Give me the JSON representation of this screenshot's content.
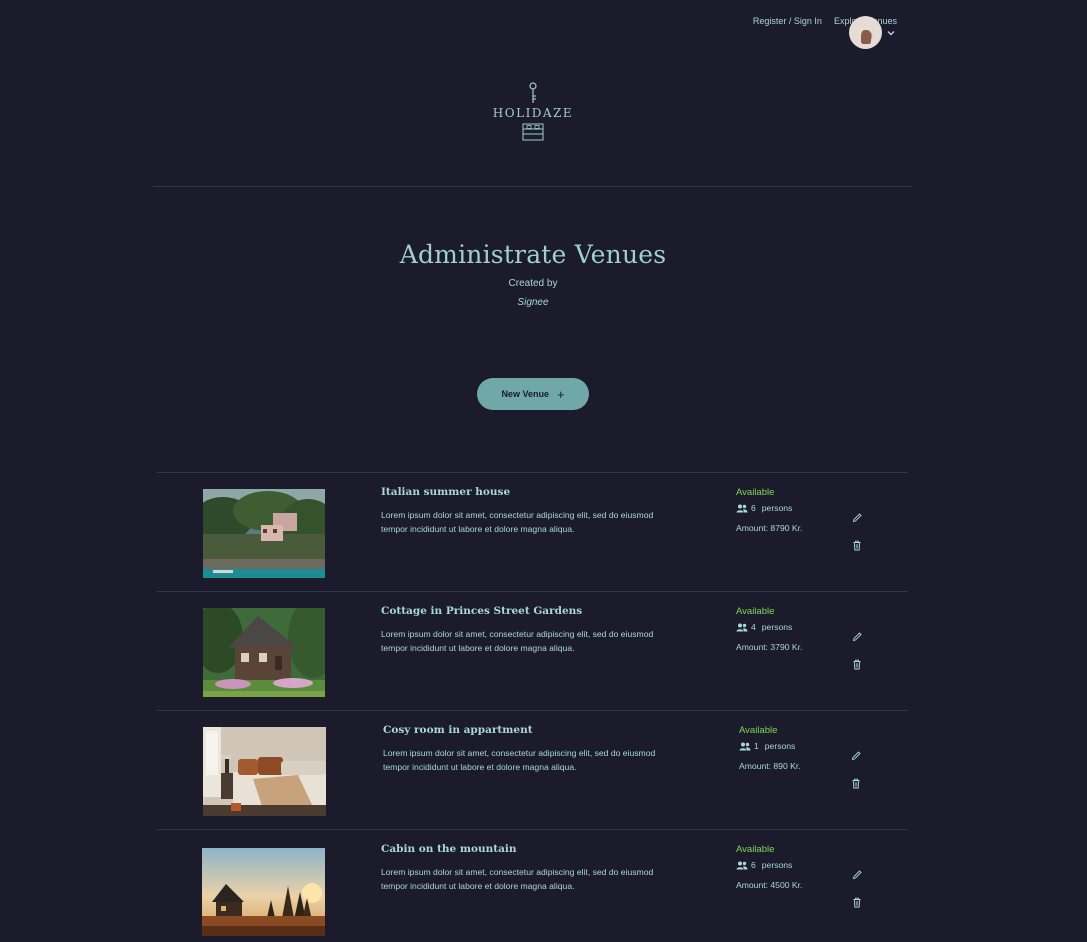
{
  "nav": {
    "register_label": "Register / Sign In",
    "explore_label": "Explore Venues"
  },
  "logo": {
    "text": "HOLIDAZE"
  },
  "page": {
    "title": "Administrate Venues",
    "created_by_label": "Created by",
    "author": "Signee"
  },
  "new_venue": {
    "label": "New Venue",
    "icon": "plus-icon"
  },
  "colors": {
    "background": "#1b1b2b",
    "text": "#9fcfcf",
    "accent": "#6fa8a6",
    "available": "#7fd65b"
  },
  "venues": [
    {
      "title": "Italian summer house",
      "description": "Lorem ipsum dolor sit amet, consectetur adipiscing elit, sed do eiusmod tempor incididunt ut labore et dolore magna aliqua.",
      "status": "Available",
      "persons": "6",
      "persons_label": "persons",
      "amount": "Amount: 8790 Kr.",
      "image": "coastal-villa-photo"
    },
    {
      "title": "Cottage in Princes Street Gardens",
      "description": "Lorem ipsum dolor sit amet, consectetur adipiscing elit, sed do eiusmod tempor incididunt ut labore et dolore magna aliqua.",
      "status": "Available",
      "persons": "4",
      "persons_label": "persons",
      "amount": "Amount: 3790 Kr.",
      "image": "stone-cottage-photo"
    },
    {
      "title": "Cosy room in appartment",
      "description": "Lorem ipsum dolor sit amet, consectetur adipiscing elit, sed do eiusmod tempor incididunt ut labore et dolore magna aliqua.",
      "status": "Available",
      "persons": "1",
      "persons_label": "persons",
      "amount": "Amount: 890 Kr.",
      "image": "bedroom-photo"
    },
    {
      "title": "Cabin on the mountain",
      "description": "Lorem ipsum dolor sit amet, consectetur adipiscing elit, sed do eiusmod tempor incididunt ut labore et dolore magna aliqua.",
      "status": "Available",
      "persons": "6",
      "persons_label": "persons",
      "amount": "Amount: 4500 Kr.",
      "image": "mountain-cabin-photo"
    }
  ]
}
